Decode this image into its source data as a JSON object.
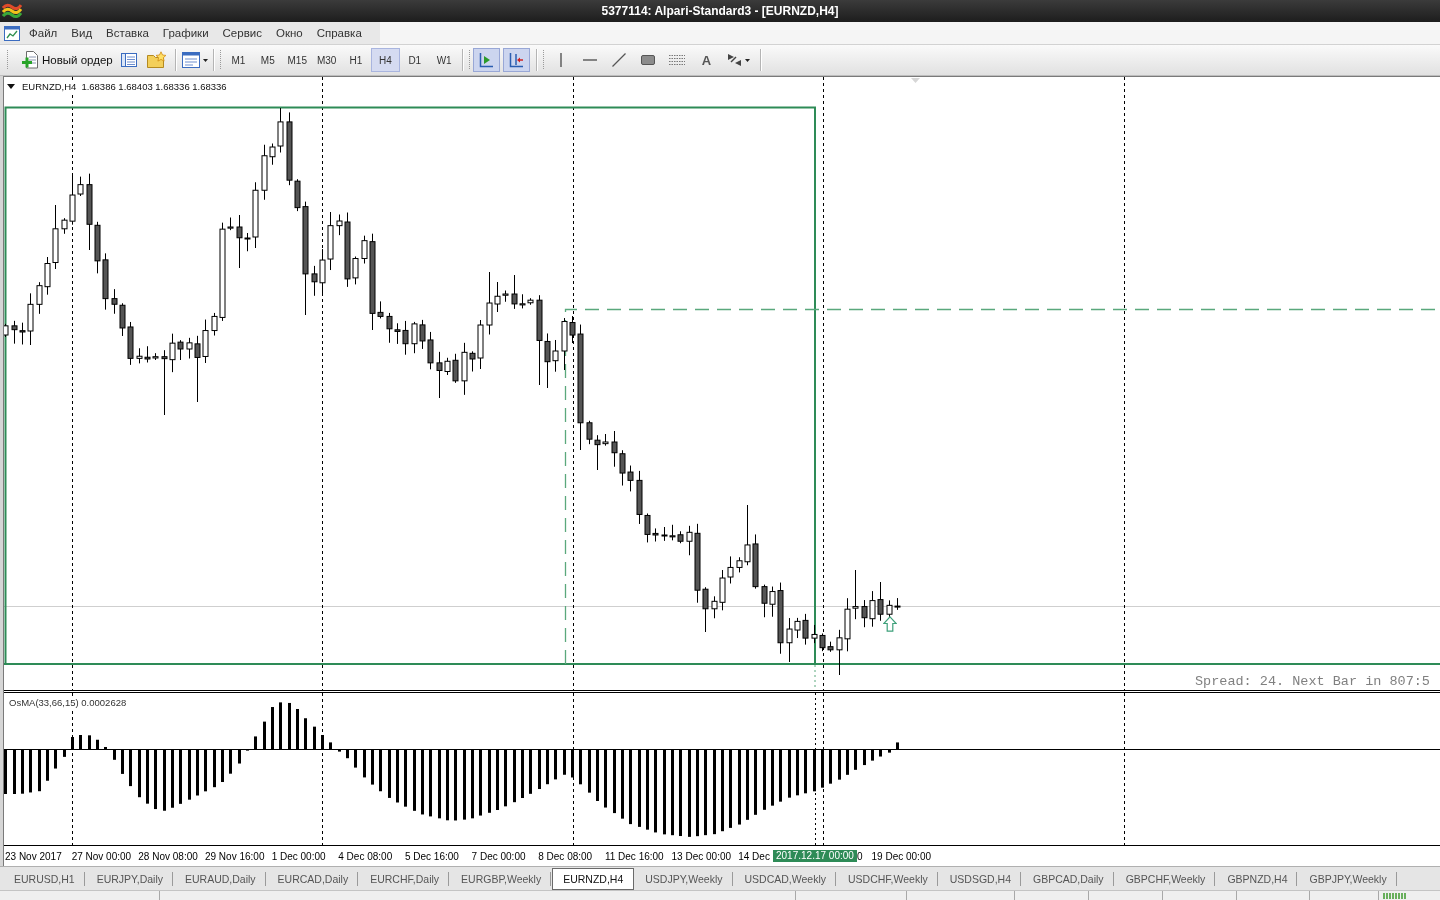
{
  "window": {
    "title": "5377114: Alpari-Standard3 - [EURNZD,H4]"
  },
  "menu": [
    "Файл",
    "Вид",
    "Вставка",
    "Графики",
    "Сервис",
    "Окно",
    "Справка"
  ],
  "toolbar": {
    "new_order": "Новый ордер",
    "periods": [
      {
        "label": "M1",
        "selected": false
      },
      {
        "label": "M5",
        "selected": false
      },
      {
        "label": "M15",
        "selected": false
      },
      {
        "label": "M30",
        "selected": false
      },
      {
        "label": "H1",
        "selected": false
      },
      {
        "label": "H4",
        "selected": true
      },
      {
        "label": "D1",
        "selected": false
      },
      {
        "label": "W1",
        "selected": false
      }
    ],
    "toggles": [
      {
        "on": true
      },
      {
        "on": true
      }
    ],
    "text_tool": "A"
  },
  "chart": {
    "symbol": "EURNZD,H4",
    "quote": "1.68386 1.68403 1.68336 1.68336",
    "info": "Spread: 24. Next Bar in 807:5",
    "indicator": "OsMA(33,66,15) 0.0002628",
    "time_labels": [
      {
        "text": "23 Nov 2017",
        "kind": "tick"
      },
      {
        "text": "27 Nov 00:00",
        "kind": "tick"
      },
      {
        "text": "28 Nov 08:00",
        "kind": "tick"
      },
      {
        "text": "29 Nov 16:00",
        "kind": "tick"
      },
      {
        "text": "1 Dec 00:00",
        "kind": "tick"
      },
      {
        "text": "4 Dec 08:00",
        "kind": "tick"
      },
      {
        "text": "5 Dec 16:00",
        "kind": "tick"
      },
      {
        "text": "7 Dec 00:00",
        "kind": "tick"
      },
      {
        "text": "8 Dec 08:00",
        "kind": "tick"
      },
      {
        "text": "11 Dec 16:00",
        "kind": "tick"
      },
      {
        "text": "13 Dec 00:00",
        "kind": "tick"
      },
      {
        "text": "14 Dec",
        "kind": "tick"
      },
      {
        "text": "2017.12.17 00:00",
        "kind": "cursor"
      },
      {
        "text": "0",
        "kind": "clipped"
      },
      {
        "text": "19 Dec 00:00",
        "kind": "tick"
      }
    ]
  },
  "tabs": [
    {
      "label": "EURUSD,H1",
      "selected": false
    },
    {
      "label": "EURJPY,Daily",
      "selected": false
    },
    {
      "label": "EURAUD,Daily",
      "selected": false
    },
    {
      "label": "EURCAD,Daily",
      "selected": false
    },
    {
      "label": "EURCHF,Daily",
      "selected": false
    },
    {
      "label": "EURGBP,Weekly",
      "selected": false
    },
    {
      "label": "EURNZD,H4",
      "selected": true
    },
    {
      "label": "USDJPY,Weekly",
      "selected": false
    },
    {
      "label": "USDCAD,Weekly",
      "selected": false
    },
    {
      "label": "USDCHF,Weekly",
      "selected": false
    },
    {
      "label": "USDSGD,H4",
      "selected": false
    },
    {
      "label": "GBPCAD,Daily",
      "selected": false
    },
    {
      "label": "GBPCHF,Weekly",
      "selected": false
    },
    {
      "label": "GBPNZD,H4",
      "selected": false
    },
    {
      "label": "GBPJPY,Weekly",
      "selected": false
    }
  ]
}
